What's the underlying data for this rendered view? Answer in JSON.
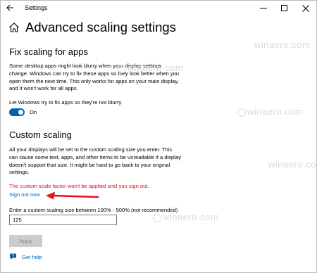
{
  "window": {
    "title": "Settings"
  },
  "page": {
    "title": "Advanced scaling settings"
  },
  "fix_scaling": {
    "heading": "Fix scaling for apps",
    "description": "Some desktop apps might look blurry when your display settings change. Windows can try to fix these apps so they look better when you open them the next time. This only works for apps on your main display, and it won't work for all apps.",
    "toggle_label": "Let Windows try to fix apps so they're not blurry",
    "toggle_state": "On"
  },
  "custom_scaling": {
    "heading": "Custom scaling",
    "description": "All your displays will be set to the custom scaling size you enter. This can cause some text, apps, and other items to be unreadable if a display doesn't support that size. It might be hard to go back to your original settings.",
    "warning": "The custom scale factor won't be applied until you sign out.",
    "sign_out_link": "Sign out now",
    "entry_label": "Enter a custom scaling size between 100% - 500% (not recommended)",
    "entry_value": "125",
    "apply_label": "Apply"
  },
  "help": {
    "label": "Get help"
  },
  "watermark": {
    "text": "winaero.com"
  },
  "colors": {
    "accent": "#0063b1",
    "warning": "#e81123",
    "arrow": "#e81123",
    "disabled_button": "#cccccc"
  }
}
